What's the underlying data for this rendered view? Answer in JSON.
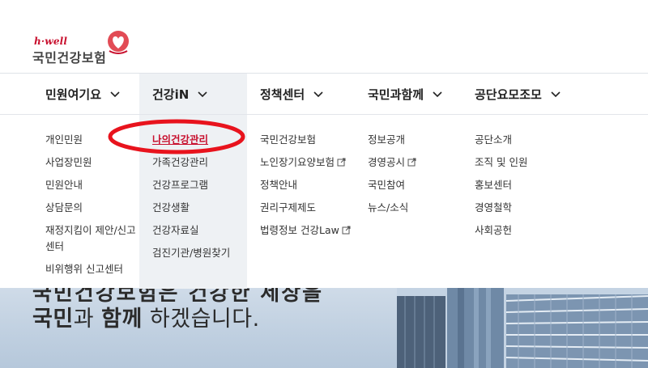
{
  "logo": {
    "tagline": "h·well",
    "name": "국민건강보험",
    "brand_color": "#c8102e"
  },
  "hero": {
    "line1": "국민건강보험은 건강한 세상을",
    "line2_part1": "국민",
    "line2_part2": "과 ",
    "line2_part3": "함께",
    "line2_part4": " 하겠습니다."
  },
  "gnb": {
    "menus": [
      {
        "label": "민원여기요",
        "items": [
          "개인민원",
          "사업장민원",
          "민원안내",
          "상담문의",
          "재정지킴이 제안/신고센터",
          "비위행위 신고센터"
        ]
      },
      {
        "label": "건강iN",
        "active": true,
        "items": [
          "나의건강관리",
          "가족건강관리",
          "건강프로그램",
          "건강생활",
          "건강자료실",
          "검진기관/병원찾기"
        ]
      },
      {
        "label": "정책센터",
        "items": [
          "국민건강보험",
          "노인장기요양보험",
          "정책안내",
          "권리구제제도",
          "법령정보 건강Law"
        ]
      },
      {
        "label": "국민과함께",
        "items": [
          "정보공개",
          "경영공시",
          "국민참여",
          "뉴스/소식"
        ]
      },
      {
        "label": "공단요모조모",
        "items": [
          "공단소개",
          "조직 및 인원",
          "홍보센터",
          "경영철학",
          "사회공헌"
        ]
      }
    ],
    "highlight_color": "#e8131d",
    "active_bg": "#eef1f4"
  }
}
